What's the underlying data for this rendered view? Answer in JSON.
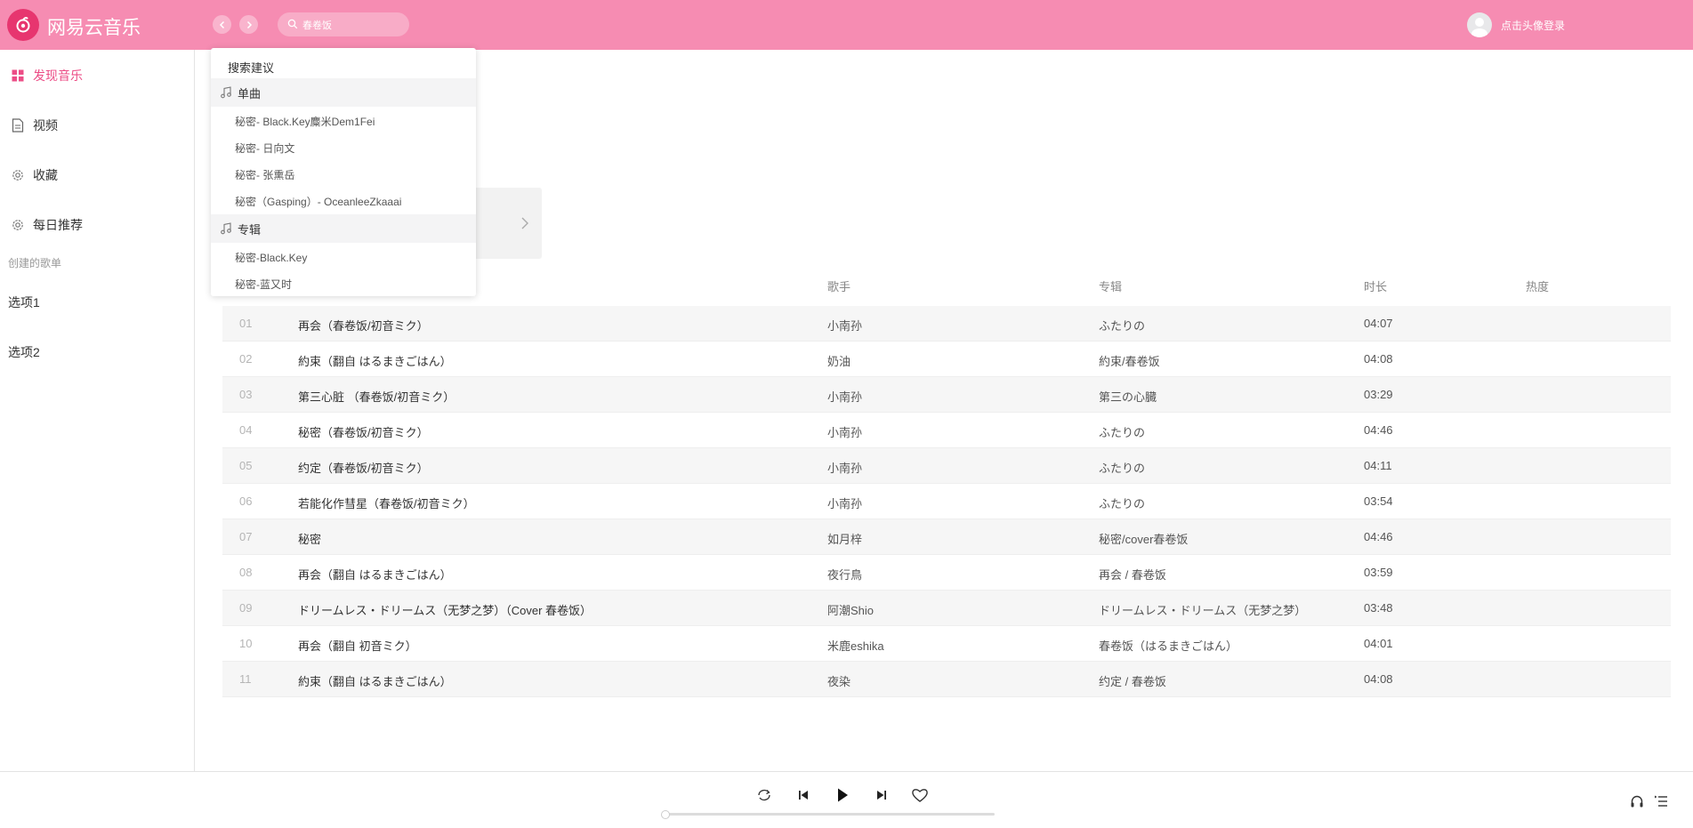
{
  "app": {
    "name": "网易云音乐",
    "login_text": "点击头像登录",
    "accent_color": "#f68cb2",
    "active_color": "#ec4d86"
  },
  "search": {
    "value": "春卷饭"
  },
  "suggestions": {
    "title": "搜索建议",
    "songs_label": "单曲",
    "songs": [
      "秘密- Black.Key麋米Dem1Fei",
      "秘密- 日向文",
      "秘密- 张熏岳",
      "秘密（Gasping）- OceanleeZkaaai"
    ],
    "albums_label": "专辑",
    "albums": [
      "秘密-Black.Key",
      "秘密-蓝又时"
    ]
  },
  "sidebar": {
    "items": [
      {
        "label": "发现音乐",
        "icon": "grid-icon"
      },
      {
        "label": "视频",
        "icon": "document-icon"
      },
      {
        "label": "收藏",
        "icon": "gear-icon"
      },
      {
        "label": "每日推荐",
        "icon": "gear-icon"
      }
    ],
    "group_label": "创建的歌单",
    "options": [
      "选项1",
      "选项2"
    ]
  },
  "table": {
    "headers": {
      "artist": "歌手",
      "album": "专辑",
      "duration": "时长",
      "heat": "热度"
    },
    "rows": [
      {
        "num": "01",
        "title": "再会（春卷饭/初音ミク）",
        "artist": "小南孙",
        "album": "ふたりの",
        "duration": "04:07"
      },
      {
        "num": "02",
        "title": "約束（翻自 はるまきごはん）",
        "artist": "奶油",
        "album": "約束/春卷饭",
        "duration": "04:08"
      },
      {
        "num": "03",
        "title": "第三心脏 （春卷饭/初音ミク）",
        "artist": "小南孙",
        "album": "第三の心臓",
        "duration": "03:29"
      },
      {
        "num": "04",
        "title": "秘密（春卷饭/初音ミク）",
        "artist": "小南孙",
        "album": "ふたりの",
        "duration": "04:46"
      },
      {
        "num": "05",
        "title": "约定（春卷饭/初音ミク）",
        "artist": "小南孙",
        "album": "ふたりの",
        "duration": "04:11"
      },
      {
        "num": "06",
        "title": "若能化作彗星（春卷饭/初音ミク）",
        "artist": "小南孙",
        "album": "ふたりの",
        "duration": "03:54"
      },
      {
        "num": "07",
        "title": "秘密",
        "artist": "如月梓",
        "album": "秘密/cover春卷饭",
        "duration": "04:46"
      },
      {
        "num": "08",
        "title": "再会（翻自 はるまきごはん）",
        "artist": "夜行鳥",
        "album": "再会 / 春卷饭",
        "duration": "03:59"
      },
      {
        "num": "09",
        "title": "ドリームレス・ドリームス（无梦之梦）（Cover 春卷饭）",
        "artist": "阿潮Shio",
        "album": "ドリームレス・ドリームス（无梦之梦）",
        "duration": "03:48"
      },
      {
        "num": "10",
        "title": "再会（翻自 初音ミク）",
        "artist": "米鹿eshika",
        "album": "春卷饭（はるまきごはん）",
        "duration": "04:01"
      },
      {
        "num": "11",
        "title": "約束（翻自 はるまきごはん）",
        "artist": "夜染",
        "album": "约定 / 春卷饭",
        "duration": "04:08"
      }
    ]
  },
  "player": {
    "progress": 0
  }
}
